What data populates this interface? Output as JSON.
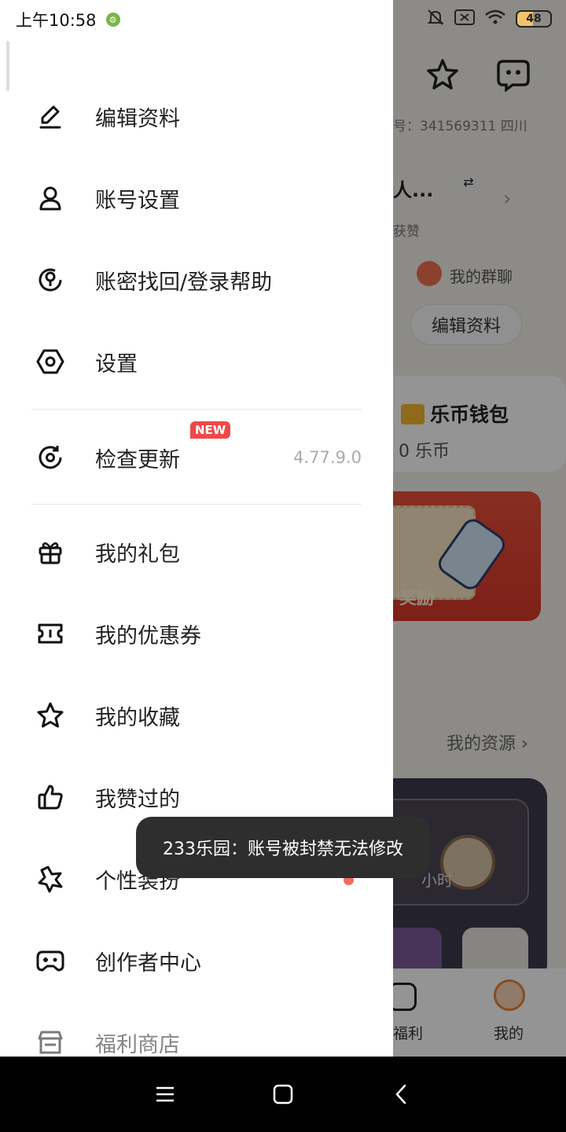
{
  "status": {
    "time": "上午10:58",
    "battery": "48"
  },
  "background": {
    "account_info": "号：341569311   四川",
    "name_partial": "人...",
    "likes_partial": "获赞",
    "group_chat": "我的群聊",
    "edit_profile": "编辑资料",
    "wallet_title": "乐币钱包",
    "wallet_value": "0 乐币",
    "banner_text": "奖励",
    "resources_link": "我的资源",
    "hours_text": "小时",
    "tabs": [
      {
        "label": "福利"
      },
      {
        "label": "我的"
      }
    ]
  },
  "drawer": {
    "items": [
      {
        "label": "编辑资料",
        "icon": "pencil-icon"
      },
      {
        "label": "账号设置",
        "icon": "user-icon"
      },
      {
        "label": "账密找回/登录帮助",
        "icon": "key-refresh-icon"
      },
      {
        "label": "设置",
        "icon": "hexagon-settings-icon"
      },
      {
        "label": "检查更新",
        "icon": "refresh-icon",
        "badge": "NEW",
        "version": "4.77.9.0"
      },
      {
        "label": "我的礼包",
        "icon": "gift-icon"
      },
      {
        "label": "我的优惠券",
        "icon": "ticket-icon"
      },
      {
        "label": "我的收藏",
        "icon": "star-icon"
      },
      {
        "label": "我赞过的",
        "icon": "thumbs-up-icon"
      },
      {
        "label": "个性装扮",
        "icon": "decoration-star-icon"
      },
      {
        "label": "创作者中心",
        "icon": "gamepad-icon"
      },
      {
        "label": "福利商店",
        "icon": "store-icon"
      }
    ]
  },
  "toast": {
    "message": "233乐园：账号被封禁无法修改"
  },
  "colors": {
    "accent_red": "#f04848",
    "wallet_yellow": "#f5b82e",
    "active_tab_orange": "#e8843a"
  }
}
